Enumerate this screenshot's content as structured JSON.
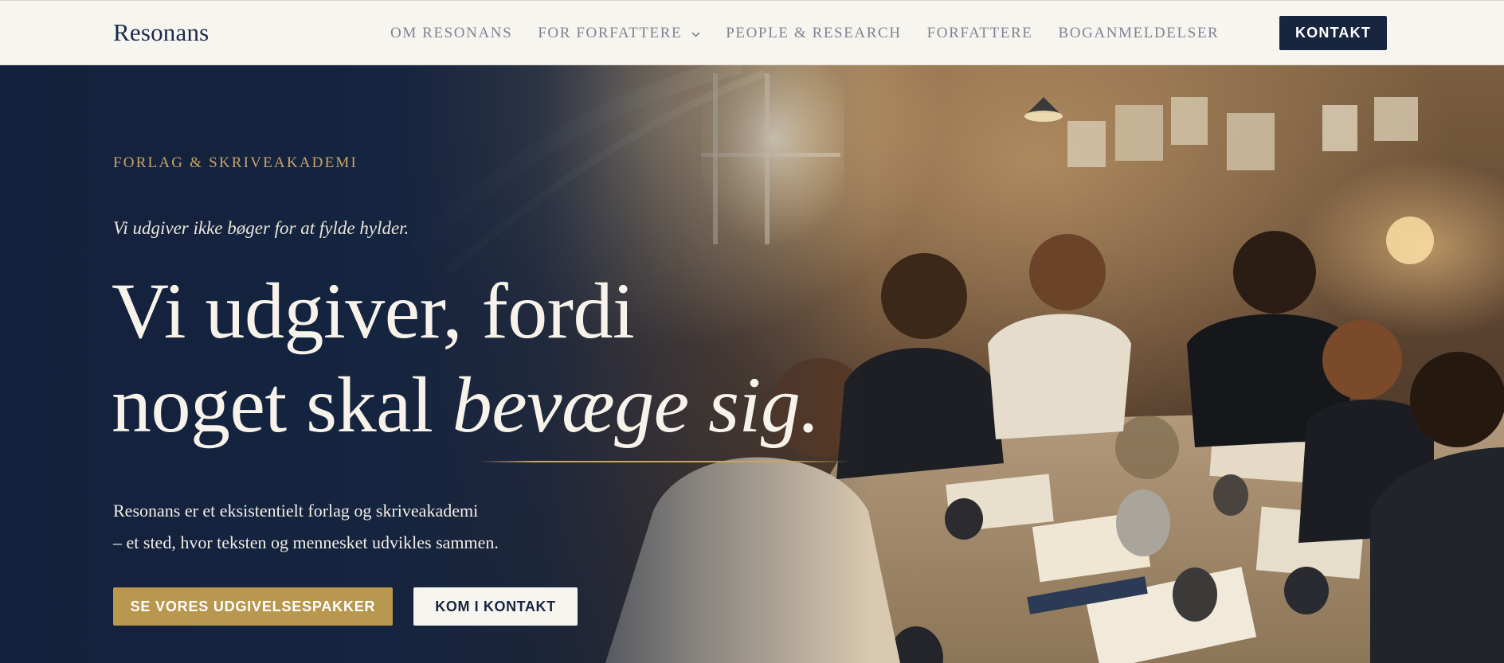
{
  "brand": {
    "name": "Resonans"
  },
  "nav": {
    "items": [
      {
        "label": "OM RESONANS"
      },
      {
        "label": "FOR FORFATTERE"
      },
      {
        "label": "PEOPLE & RESEARCH"
      },
      {
        "label": "FORFATTERE"
      },
      {
        "label": "BOGANMELDELSER"
      }
    ],
    "contact_label": "KONTAKT"
  },
  "hero": {
    "eyebrow": "FORLAG & SKRIVEAKADEMI",
    "tagline": "Vi udgiver ikke bøger for at fylde hylder.",
    "headline_line1": "Vi udgiver, fordi",
    "headline_line2_plain": "noget skal ",
    "headline_line2_italic": "bevæge sig.",
    "description_line1": "Resonans er et eksistentielt forlag og skriveakademi",
    "description_line2": "– et sted, hvor teksten og mennesket udvikles sammen.",
    "primary_button": "SE VORES UDGIVELSESPAKKER",
    "secondary_button": "KOM I KONTAKT"
  },
  "colors": {
    "navy": "#17253f",
    "gold": "#b8974e",
    "cream": "#f7f5f0",
    "nav_text": "#7e8592"
  },
  "icons": {
    "dropdown": "chevron-down-icon"
  }
}
